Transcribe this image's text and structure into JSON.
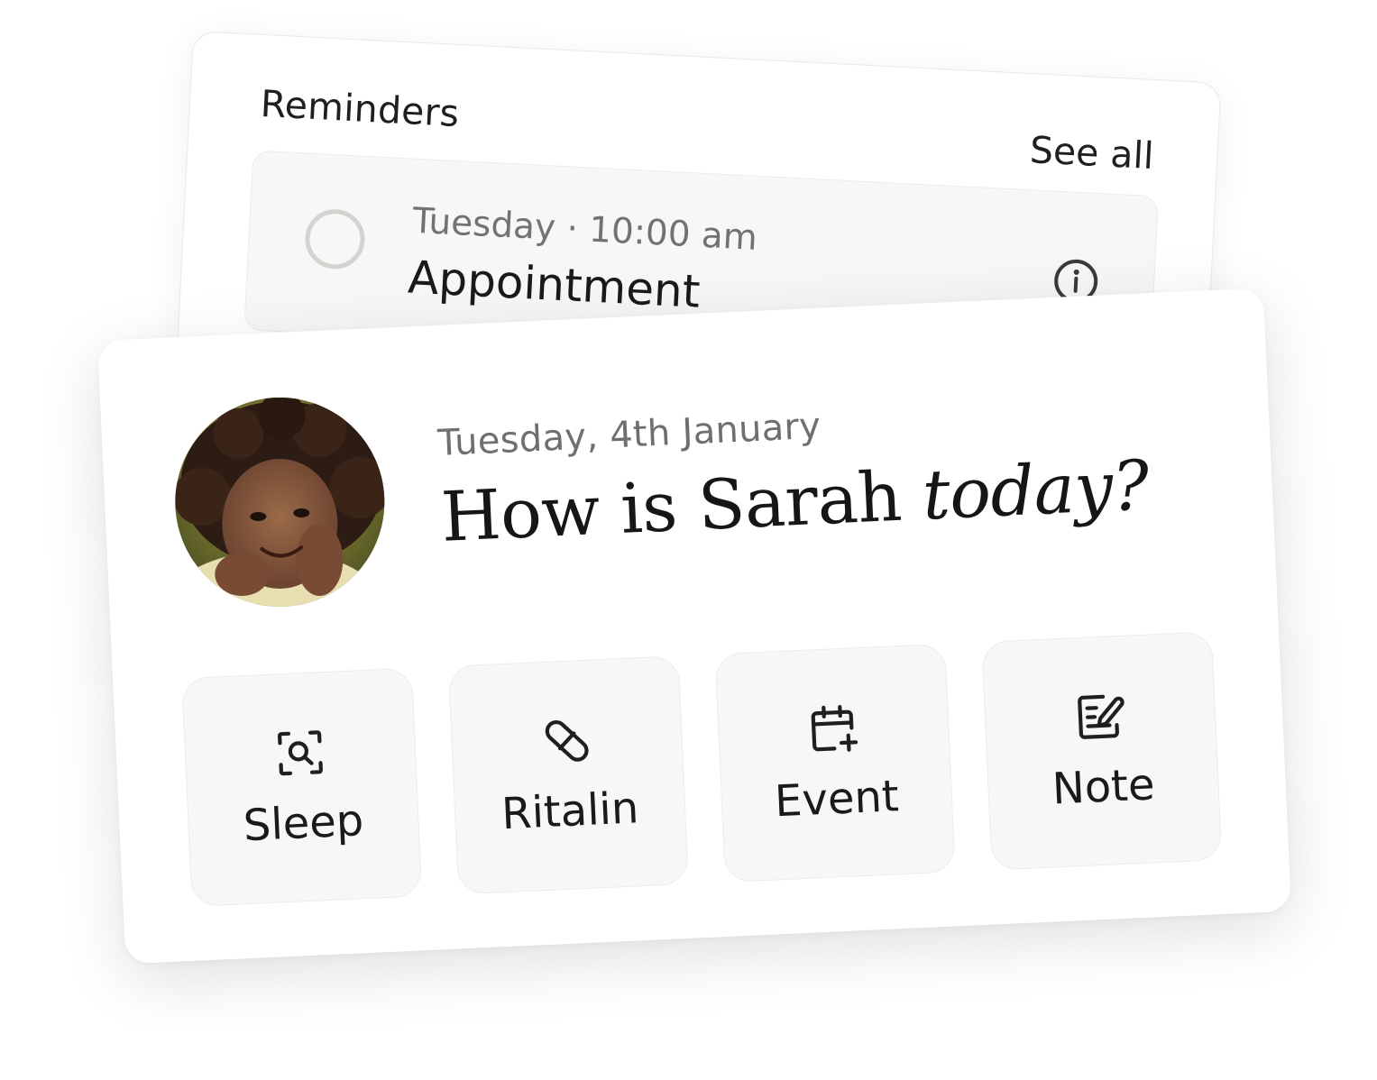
{
  "reminders": {
    "title": "Reminders",
    "see_all_label": "See all",
    "item": {
      "time": "Tuesday · 10:00 am",
      "title": "Appointment",
      "icon": "info-icon"
    }
  },
  "main": {
    "date": "Tuesday, 4th January",
    "headline_prefix": "How is Sarah ",
    "headline_emphasis": "today?",
    "avatar": "child-portrait-avatar",
    "actions": [
      {
        "label": "Sleep",
        "icon": "sleep-scan-icon"
      },
      {
        "label": "Ritalin",
        "icon": "pill-icon"
      },
      {
        "label": "Event",
        "icon": "calendar-plus-icon"
      },
      {
        "label": "Note",
        "icon": "note-edit-icon"
      }
    ]
  },
  "colors": {
    "card_background": "#ffffff",
    "tile_background": "#f7f7f7",
    "secondary_text": "#727272",
    "primary_text": "#1a1a1a"
  }
}
